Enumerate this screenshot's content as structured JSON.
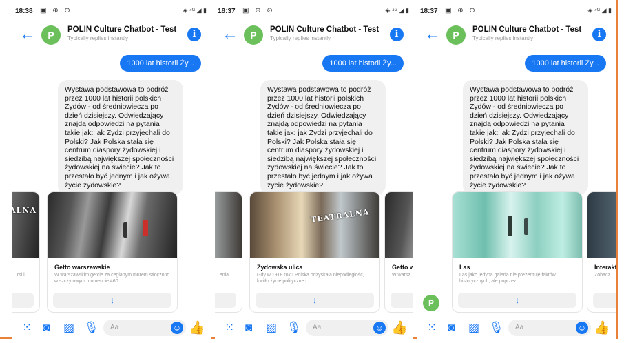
{
  "phones": [
    {
      "time": "18:38",
      "chat": {
        "title": "POLIN Culture Chatbot - Test",
        "subtitle": "Typically replies instantly",
        "avatar_letter": "P"
      },
      "outgoing": "1000 lat historii Ży...",
      "incoming": "Wystawa podstawowa to podróż przez 1000 lat historii polskich Żydów - od średniowiecza po dzień dzisiejszy. Odwiedzający znajdą odpowiedzi na pytania takie jak: jak Żydzi przyjechali do Polski? Jak Polska stała się centrum diaspory żydowskiej i siedzibą największej społeczności żydowskiej na świecie? Jak to przestało być jednym i jak ożywa życie żydowskie?",
      "cards": [
        {
          "title": "",
          "subtitle": "...rsi i..."
        },
        {
          "title": "Getto warszawskie",
          "subtitle": "W warszawskim getcie za ceglanym murem stłoczono w szczytowym momencie 460..."
        }
      ],
      "sign_text": "TEATRALNA",
      "composer": {
        "placeholder": "Aa"
      }
    },
    {
      "time": "18:37",
      "chat": {
        "title": "POLIN Culture Chatbot - Test",
        "subtitle": "Typically replies instantly",
        "avatar_letter": "P"
      },
      "outgoing": "1000 lat historii Ży...",
      "incoming": "Wystawa podstawowa to podróż przez 1000 lat historii polskich Żydów - od średniowiecza po dzień dzisiejszy. Odwiedzający znajdą odpowiedzi na pytania takie jak: jak Żydzi przyjechali do Polski? Jak Polska stała się centrum diaspory żydowskiej i siedzibą największej społeczności żydowskiej na świecie? Jak to przestało być jednym i jak ożywa życie żydowskie?",
      "cards": [
        {
          "title": "",
          "subtitle": "...enia..."
        },
        {
          "title": "Żydowska ulica",
          "subtitle": "Gdy w 1918 roku Polska odzyskała niepodległość, kwitło życie polityczne i..."
        },
        {
          "title": "Getto w",
          "subtitle": "W warsz... stłoczo..."
        }
      ],
      "sign_text": "TEATRALNA",
      "composer": {
        "placeholder": "Aa"
      }
    },
    {
      "time": "18:37",
      "chat": {
        "title": "POLIN Culture Chatbot - Test",
        "subtitle": "Typically replies instantly",
        "avatar_letter": "P"
      },
      "outgoing": "1000 lat historii Ży...",
      "incoming": "Wystawa podstawowa to podróż przez 1000 lat historii polskich Żydów - od średniowiecza po dzień dzisiejszy. Odwiedzający znajdą odpowiedzi na pytania takie jak: jak Żydzi przyjechali do Polski? Jak Polska stała się centrum diaspory żydowskiej i siedzibą największej społeczności żydowskiej na świecie? Jak to przestało być jednym i jak ożywa życie żydowskie?",
      "cards": [
        {
          "title": "Las",
          "subtitle": "Las jako jedyna galeria nie prezentuje faktów historycznych, ale poprzez..."
        },
        {
          "title": "Interakt",
          "subtitle": "Zobacz i... stolicy -..."
        }
      ],
      "bot_avatar_letter": "P",
      "composer": {
        "placeholder": "Aa"
      }
    }
  ],
  "icons": {
    "back": "arrow-left-icon",
    "info": "info-icon",
    "more": "apps-icon",
    "camera": "camera-icon",
    "gallery": "image-icon",
    "mic": "microphone-icon",
    "emoji": "smiley-icon",
    "like": "thumbs-up-icon",
    "card_button": "arrow-down-icon"
  },
  "colors": {
    "accent": "#1877f2",
    "avatar": "#6bc05c",
    "frame": "#e8823a"
  }
}
